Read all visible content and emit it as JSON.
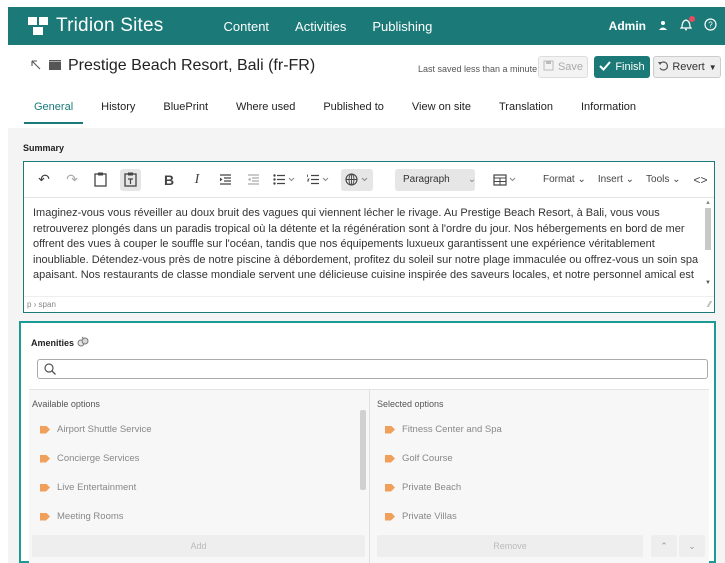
{
  "app": {
    "brand": "Tridion Sites",
    "nav": [
      "Content",
      "Activities",
      "Publishing"
    ],
    "user": "Admin",
    "colors": {
      "accent": "#1b7a78",
      "tag": "#f0a05a"
    }
  },
  "item": {
    "title": "Prestige Beach Resort, Bali (fr-FR)",
    "saved_status": "Last saved less than a minute",
    "save_label": "Save",
    "finish_label": "Finish",
    "revert_label": "Revert"
  },
  "tabs": [
    {
      "label": "General",
      "active": true
    },
    {
      "label": "History"
    },
    {
      "label": "BluePrint"
    },
    {
      "label": "Where used"
    },
    {
      "label": "Published to"
    },
    {
      "label": "View on site"
    },
    {
      "label": "Translation"
    },
    {
      "label": "Information"
    }
  ],
  "summary": {
    "label": "Summary",
    "block_format": "Paragraph",
    "menus": [
      "Format",
      "Insert",
      "Tools"
    ],
    "text": "Imaginez-vous vous réveiller au doux bruit des vagues qui viennent lécher le rivage. Au Prestige Beach Resort, à Bali, vous vous retrouverez plongés dans un paradis tropical où la détente et la régénération sont à l'ordre du jour. Nos hébergements en bord de mer offrent des vues à couper le souffle sur l'océan, tandis que nos équipements luxueux garantissent une expérience véritablement inoubliable. Détendez-vous près de notre piscine à débordement, profitez du soleil sur notre plage immaculée ou offrez-vous un soin spa apaisant. Nos restaurants de classe mondiale servent une délicieuse cuisine inspirée des saveurs locales, et notre personnel amical est toujours prêt à répondre à vos besoins. Que vous recherchiez une escapade romantique, des vacances en famille ou une aventure en solo, le Prestige Beach Resort à Bali offre l'évasion",
    "status_path": "p › span"
  },
  "amenities": {
    "label": "Amenities",
    "search_placeholder": "",
    "available_header": "Available options",
    "selected_header": "Selected options",
    "available": [
      "Airport Shuttle Service",
      "Concierge Services",
      "Live Entertainment",
      "Meeting Rooms"
    ],
    "selected": [
      "Fitness Center and Spa",
      "Golf Course",
      "Private Beach",
      "Private Villas"
    ],
    "add_label": "Add",
    "remove_label": "Remove"
  }
}
